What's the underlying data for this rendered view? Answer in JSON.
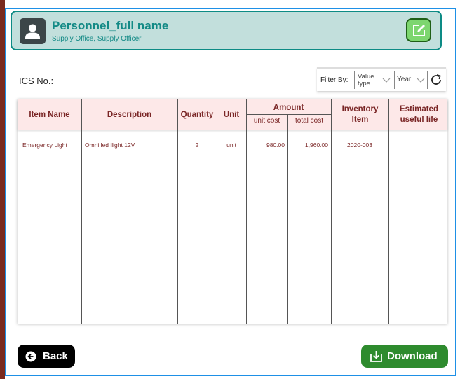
{
  "header": {
    "name": "Personnel_full name",
    "subtitle": "Supply Office, Supply Officer"
  },
  "ics_label": "ICS No.:",
  "filter": {
    "label": "Filter By:",
    "value_type": "Value type",
    "year": "Year"
  },
  "table": {
    "headers": {
      "item_name": "Item Name",
      "description": "Description",
      "quantity": "Quantity",
      "unit": "Unit",
      "amount": "Amount",
      "unit_cost": "unit cost",
      "total_cost": "total cost",
      "inventory_item": "Inventory Item",
      "useful_life": "Estimated useful life"
    },
    "rows": [
      {
        "item_name": "Emergency Light",
        "description": "Omni led llight 12V",
        "quantity": "2",
        "unit": "unit",
        "unit_cost": "980.00",
        "total_cost": "1,960.00",
        "inventory_item": "2020-003",
        "useful_life": ""
      }
    ]
  },
  "buttons": {
    "back": "Back",
    "download": "Download"
  },
  "colors": {
    "frame": "#1e90e6",
    "header_bg": "#c2dfdc",
    "header_text": "#138a86",
    "table_header_bg": "#fde8e8",
    "table_text": "#7a2626",
    "download_bg": "#2e8b2e",
    "back_bg": "#000000"
  }
}
